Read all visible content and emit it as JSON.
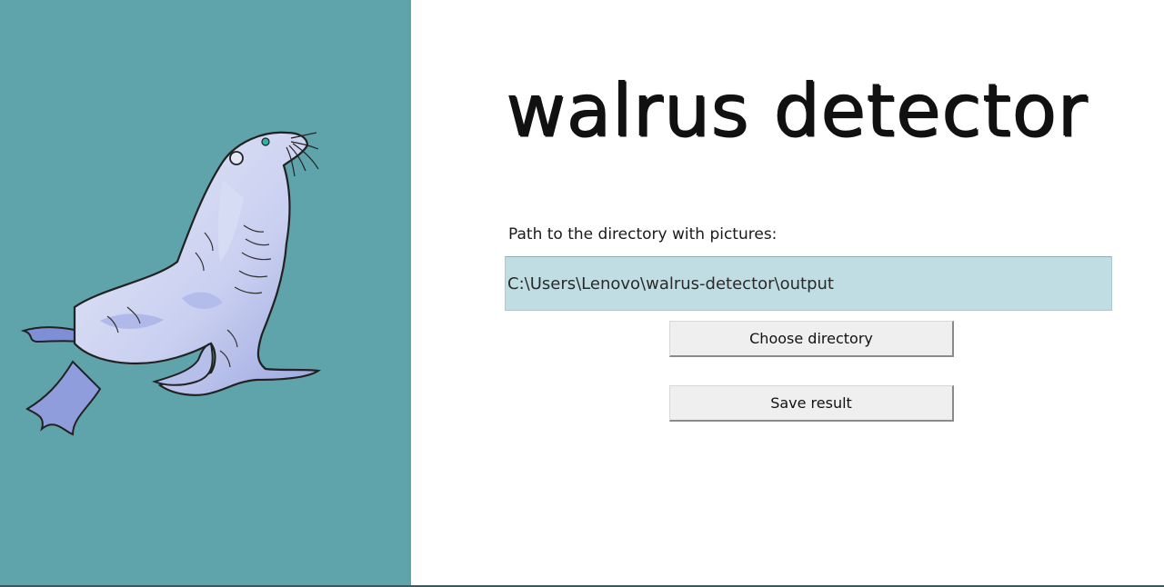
{
  "app": {
    "title": "walrus detector"
  },
  "form": {
    "path_label": "Path to the directory with pictures:",
    "path_value": "C:\\Users\\Lenovo\\walrus-detector\\output"
  },
  "buttons": {
    "choose_label": "Choose directory",
    "save_label": "Save result"
  },
  "illustration": {
    "icon": "walrus-illustration"
  },
  "colors": {
    "left_panel": "#5fa4aa",
    "input_background": "#bfdde2",
    "button_background": "#efefef"
  }
}
